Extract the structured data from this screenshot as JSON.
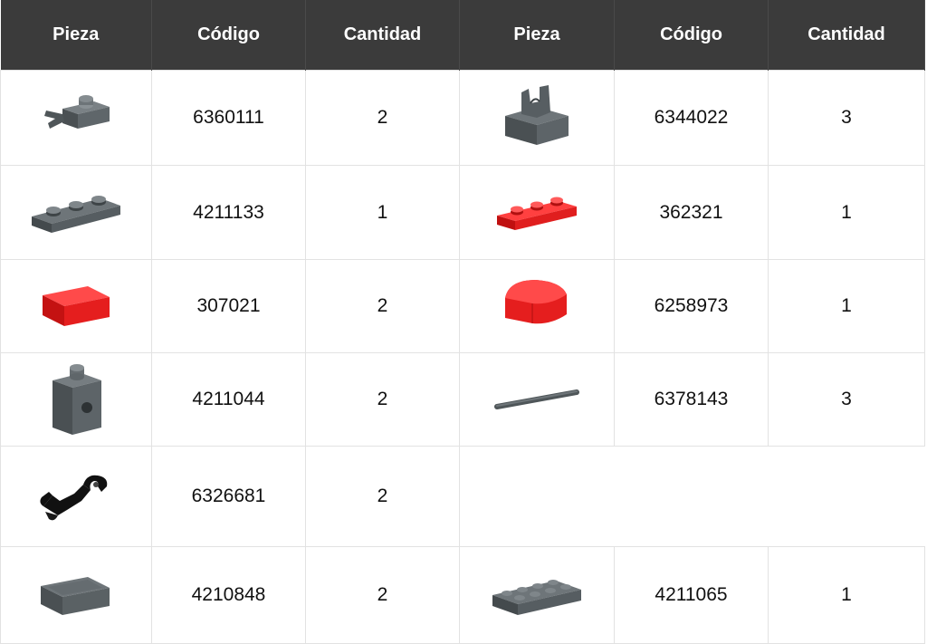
{
  "header": {
    "left": {
      "pieza": "Pieza",
      "codigo": "Código",
      "cantidad": "Cantidad"
    },
    "right": {
      "pieza": "Pieza",
      "codigo": "Código",
      "cantidad": "Cantidad"
    }
  },
  "colors": {
    "header_bg": "#3b3b3b",
    "dark_gray": "#5a6164",
    "red": "#e51e1e",
    "black": "#111111"
  },
  "rows": [
    {
      "left": {
        "icon": "plate-with-clip-icon",
        "code": "6360111",
        "qty": "2"
      },
      "right": {
        "icon": "tile-with-clip-icon",
        "code": "6344022",
        "qty": "3"
      }
    },
    {
      "left": {
        "icon": "plate-1x3-dark-gray-icon",
        "code": "4211133",
        "qty": "1"
      },
      "right": {
        "icon": "plate-1x3-red-icon",
        "code": "362321",
        "qty": "1"
      }
    },
    {
      "left": {
        "icon": "tile-2x2-red-icon",
        "code": "307021",
        "qty": "2"
      },
      "right": {
        "icon": "tile-round-corner-red-icon",
        "code": "6258973",
        "qty": "1"
      }
    },
    {
      "left": {
        "icon": "brick-with-hole-icon",
        "code": "4211044",
        "qty": "2"
      },
      "right": {
        "icon": "bar-icon",
        "code": "6378143",
        "qty": "3"
      }
    },
    {
      "left": {
        "icon": "double-clip-black-icon",
        "code": "6326681",
        "qty": "2"
      },
      "right": null
    },
    {
      "left": {
        "icon": "tile-2x2-dark-gray-icon",
        "code": "4210848",
        "qty": "2"
      },
      "right": {
        "icon": "plate-2x4-dark-gray-icon",
        "code": "4211065",
        "qty": "1"
      }
    }
  ]
}
